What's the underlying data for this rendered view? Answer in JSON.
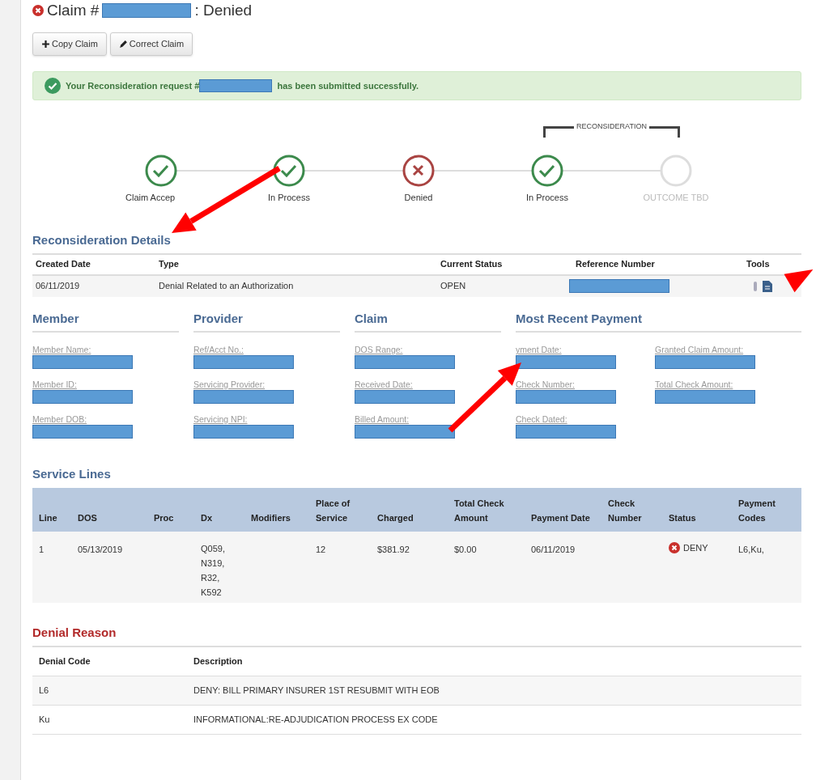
{
  "header": {
    "kind": "denied",
    "title_prefix": "Claim #",
    "title_suffix": ": Denied"
  },
  "buttons": [
    {
      "kind": "plus",
      "label": "Copy Claim"
    },
    {
      "kind": "pencil",
      "label": "Correct Claim"
    }
  ],
  "alert": {
    "kind": "success",
    "prefix": "Your Reconsideration request #",
    "suffix": "has been submitted successfully."
  },
  "progress": {
    "bracket_label": "RECONSIDERATION",
    "steps": [
      {
        "label": "Claim Accep",
        "kind": "done",
        "bracketed": false
      },
      {
        "label": "In Process",
        "kind": "done",
        "bracketed": false
      },
      {
        "label": "Denied",
        "kind": "denied",
        "bracketed": false
      },
      {
        "label": "In Process",
        "kind": "done",
        "bracketed": true
      },
      {
        "label": "OUTCOME TBD",
        "kind": "pending",
        "bracketed": true
      }
    ]
  },
  "reconsideration": {
    "title": "Reconsideration Details",
    "columns": [
      "Created Date",
      "Type",
      "Current Status",
      "Reference Number",
      "Tools"
    ],
    "rows": [
      {
        "cells": [
          {
            "kind": "text",
            "text": "06/11/2019"
          },
          {
            "kind": "text",
            "text": "Denial Related to an Authorization"
          },
          {
            "kind": "text",
            "text": "OPEN"
          },
          {
            "kind": "redacted"
          },
          {
            "kind": "tools"
          }
        ]
      }
    ]
  },
  "sections": [
    {
      "title": "Member",
      "columns": [
        [
          "Member Name:",
          "Member ID:",
          "Member DOB:"
        ]
      ]
    },
    {
      "title": "Provider",
      "columns": [
        [
          "Ref/Acct No.:",
          "Servicing Provider:",
          "Servicing NPI:"
        ]
      ]
    },
    {
      "title": "Claim",
      "columns": [
        [
          "DOS Range:",
          "Received Date:",
          "Billed Amount:"
        ]
      ]
    },
    {
      "title": "Most Recent Payment",
      "columns": [
        [
          "yment Date:",
          "Check Number:",
          "Check Dated:"
        ],
        [
          "Granted Claim Amount:",
          "Total Check Amount:"
        ]
      ]
    }
  ],
  "service_lines": {
    "title": "Service Lines",
    "columns": [
      "Line",
      "DOS",
      "Proc",
      "Dx",
      "Modifiers",
      "Place of Service",
      "Charged",
      "Total Check Amount",
      "Payment Date",
      "Check Number",
      "Status",
      "Payment Codes"
    ],
    "rows": [
      {
        "line": "1",
        "dos": "05/13/2019",
        "dx": [
          "Q059,",
          "N319,",
          "R32,",
          "K592"
        ],
        "place_of_service": "12",
        "charged": "$381.92",
        "total_check_amount": "$0.00",
        "payment_date": "06/11/2019",
        "status": {
          "kind": "denied",
          "text": "DENY"
        },
        "payment_codes": "L6,Ku,"
      }
    ]
  },
  "denial_reason": {
    "title": "Denial Reason",
    "columns": [
      "Denial Code",
      "Description"
    ],
    "rows": [
      {
        "code": "L6",
        "description": "DENY: BILL PRIMARY INSURER 1ST RESUBMIT WITH EOB"
      },
      {
        "code": "Ku",
        "description": "INFORMATIONAL:RE-ADJUDICATION PROCESS EX CODE"
      }
    ]
  },
  "annotations": [
    {
      "kind": "arrow"
    },
    {
      "kind": "arrow"
    },
    {
      "kind": "arrow"
    }
  ]
}
